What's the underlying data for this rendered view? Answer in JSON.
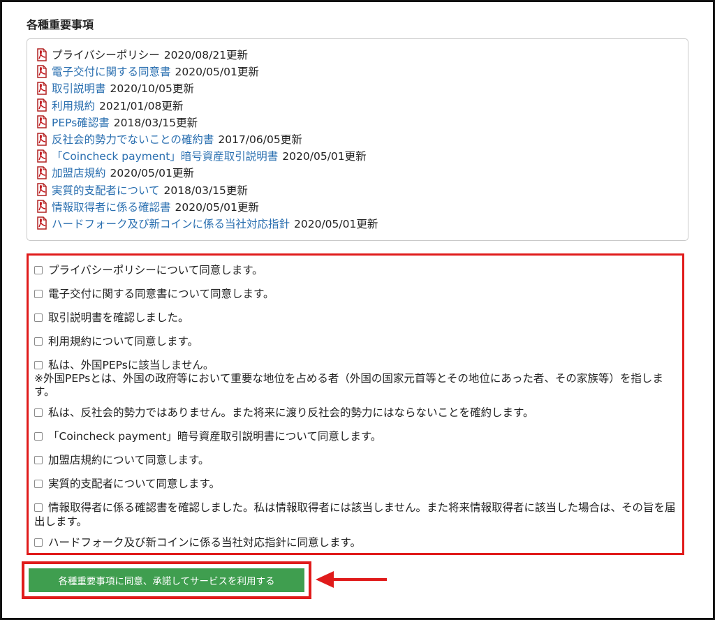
{
  "section_title": "各種重要事項",
  "documents": [
    {
      "name": "プライバシーポリシー",
      "date": "2020/08/21更新",
      "link": false
    },
    {
      "name": "電子交付に関する同意書",
      "date": "2020/05/01更新",
      "link": true
    },
    {
      "name": "取引説明書",
      "date": "2020/10/05更新",
      "link": true
    },
    {
      "name": "利用規約",
      "date": "2021/01/08更新",
      "link": true
    },
    {
      "name": "PEPs確認書",
      "date": "2018/03/15更新",
      "link": true
    },
    {
      "name": "反社会的勢力でないことの確約書",
      "date": "2017/06/05更新",
      "link": true
    },
    {
      "name": "「Coincheck payment」暗号資産取引説明書",
      "date": "2020/05/01更新",
      "link": true
    },
    {
      "name": "加盟店規約",
      "date": "2020/05/01更新",
      "link": true
    },
    {
      "name": "実質的支配者について",
      "date": "2018/03/15更新",
      "link": true
    },
    {
      "name": "情報取得者に係る確認書",
      "date": "2020/05/01更新",
      "link": true
    },
    {
      "name": "ハードフォーク及び新コインに係る当社対応指針",
      "date": "2020/05/01更新",
      "link": true
    }
  ],
  "agreements": [
    {
      "label": "プライバシーポリシーについて同意します。",
      "checked": false
    },
    {
      "label": "電子交付に関する同意書について同意します。",
      "checked": false
    },
    {
      "label": "取引説明書を確認しました。",
      "checked": false
    },
    {
      "label": "利用規約について同意します。",
      "checked": false
    },
    {
      "label": "私は、外国PEPsに該当しません。",
      "checked": false,
      "note": "※外国PEPsとは、外国の政府等において重要な地位を占める者（外国の国家元首等とその地位にあった者、その家族等）を指します。"
    },
    {
      "label": "私は、反社会的勢力ではありません。また将来に渡り反社会的勢力にはならないことを確約します。",
      "checked": false
    },
    {
      "label": "「Coincheck payment」暗号資産取引説明書について同意します。",
      "checked": false
    },
    {
      "label": "加盟店規約について同意します。",
      "checked": false
    },
    {
      "label": "実質的支配者について同意します。",
      "checked": false
    },
    {
      "label": "情報取得者に係る確認書を確認しました。私は情報取得者には該当しません。また将来情報取得者に該当した場合は、その旨を届出します。",
      "checked": false
    },
    {
      "label": "ハードフォーク及び新コインに係る当社対応指針に同意します。",
      "checked": false
    }
  ],
  "submit_label": "各種重要事項に同意、承諾してサービスを利用する",
  "colors": {
    "accent_red": "#e01b1b",
    "button_green": "#3f9e4f",
    "link_blue": "#2a6fb0"
  }
}
